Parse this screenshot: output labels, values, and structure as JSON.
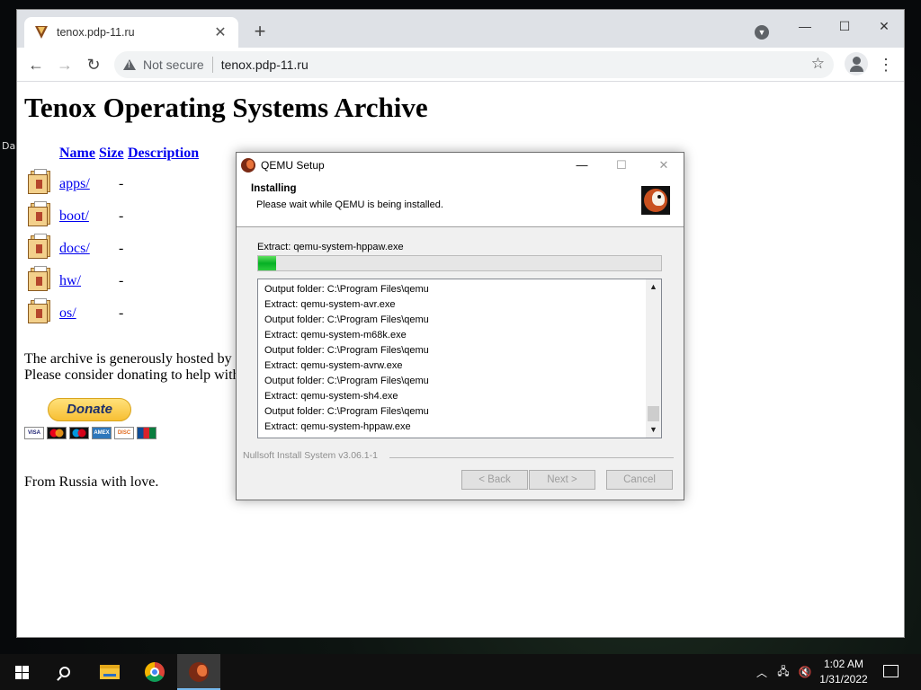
{
  "desktop": {
    "label": "Da"
  },
  "browser": {
    "tab_title": "tenox.pdp-11.ru",
    "tab_close": "✕",
    "newtab": "+",
    "not_secure": "Not secure",
    "url": "tenox.pdp-11.ru",
    "icons": {
      "minimize": "—",
      "maximize": "☐",
      "close": "✕",
      "back": "←",
      "forward": "→",
      "reload": "↻",
      "star": "☆",
      "menu": "⋮",
      "tab_search": "▼"
    }
  },
  "page": {
    "title": "Tenox Operating Systems Archive",
    "columns": [
      "Name",
      "Size",
      "Description"
    ],
    "rows": [
      {
        "name": "apps/",
        "size": "-"
      },
      {
        "name": "boot/",
        "size": "-"
      },
      {
        "name": "docs/",
        "size": "-"
      },
      {
        "name": "hw/",
        "size": "-"
      },
      {
        "name": "os/",
        "size": "-"
      }
    ],
    "hosted_line": "The archive is generously hosted by",
    "donate_line": "Please consider donating to help with",
    "donate_button": "Donate",
    "cards": [
      "VISA",
      "",
      "",
      "AMEX",
      "DISC",
      ""
    ],
    "footer": "From Russia with love."
  },
  "installer": {
    "title": "QEMU Setup",
    "heading": "Installing",
    "subheading": "Please wait while QEMU is being installed.",
    "extract_label": "Extract: qemu-system-hppaw.exe",
    "progress_percent": 4.5,
    "log": [
      "Output folder: C:\\Program Files\\qemu",
      "Extract: qemu-system-avr.exe",
      "Output folder: C:\\Program Files\\qemu",
      "Extract: qemu-system-m68k.exe",
      "Output folder: C:\\Program Files\\qemu",
      "Extract: qemu-system-avrw.exe",
      "Output folder: C:\\Program Files\\qemu",
      "Extract: qemu-system-sh4.exe",
      "Output folder: C:\\Program Files\\qemu",
      "Extract: qemu-system-hppaw.exe"
    ],
    "branding": "Nullsoft Install System v3.06.1-1",
    "buttons": {
      "back": "< Back",
      "next": "Next >",
      "cancel": "Cancel"
    },
    "window_icons": {
      "minimize": "—",
      "maximize": "☐",
      "close": "✕"
    },
    "scroll_up": "▲",
    "scroll_down": "▼"
  },
  "taskbar": {
    "time": "1:02 AM",
    "date": "1/31/2022",
    "tray": {
      "chevron": "︿",
      "network": "🖧",
      "volume": "🔇"
    }
  },
  "colors": {
    "link": "#0000ee",
    "progress": "#06b025",
    "taskbar": "#101010"
  }
}
